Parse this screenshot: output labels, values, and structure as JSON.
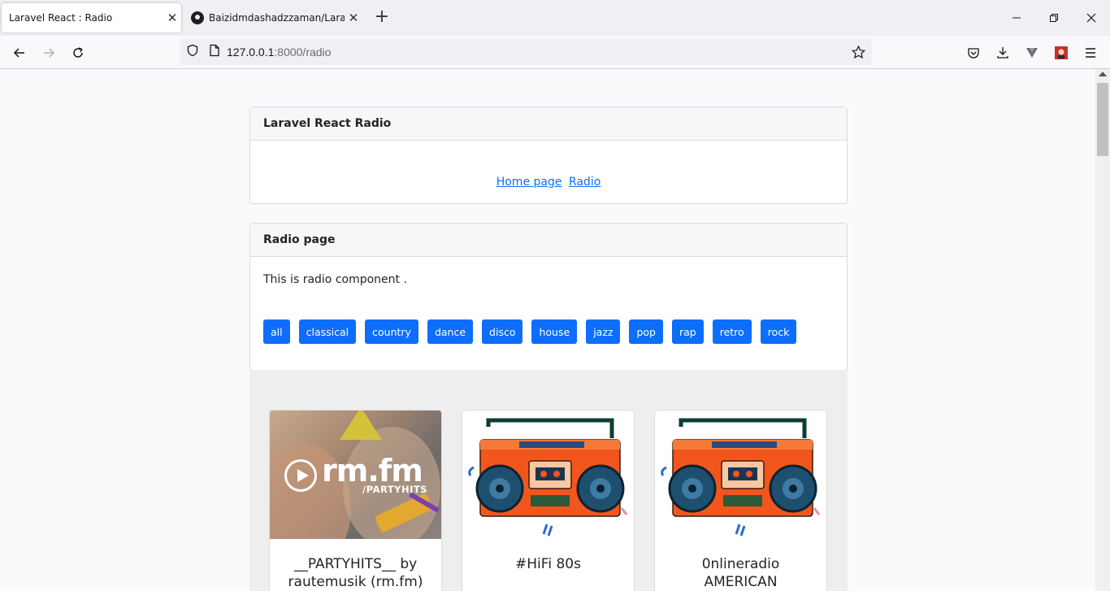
{
  "browser": {
    "tabs": [
      {
        "title": "Laravel React : Radio",
        "active": true
      },
      {
        "title": "Baizidmdashadzzaman/Laravel-",
        "active": false
      }
    ],
    "url": {
      "host": "127.0.0.1",
      "rest": ":8000/radio"
    }
  },
  "nav_card": {
    "title": "Laravel React Radio",
    "links": [
      "Home page",
      "Radio"
    ]
  },
  "radio_card": {
    "title": "Radio page",
    "intro": "This is radio component .",
    "genres": [
      "all",
      "classical",
      "country",
      "dance",
      "disco",
      "house",
      "jazz",
      "pop",
      "rap",
      "retro",
      "rock"
    ]
  },
  "stations": [
    {
      "name": "__PARTYHITS__ by rautemusik (rm.fm)",
      "logo_text": "rm.fm",
      "logo_sub": "/PARTYHITS",
      "image": "party-photo"
    },
    {
      "name": "#HiFi 80s",
      "image": "boombox-illustration"
    },
    {
      "name": "0nlineradio AMERICAN",
      "image": "boombox-illustration"
    }
  ],
  "colors": {
    "accent": "#0d6efd",
    "boombox_body": "#f2561d",
    "boombox_speaker": "#1e4f6e"
  }
}
